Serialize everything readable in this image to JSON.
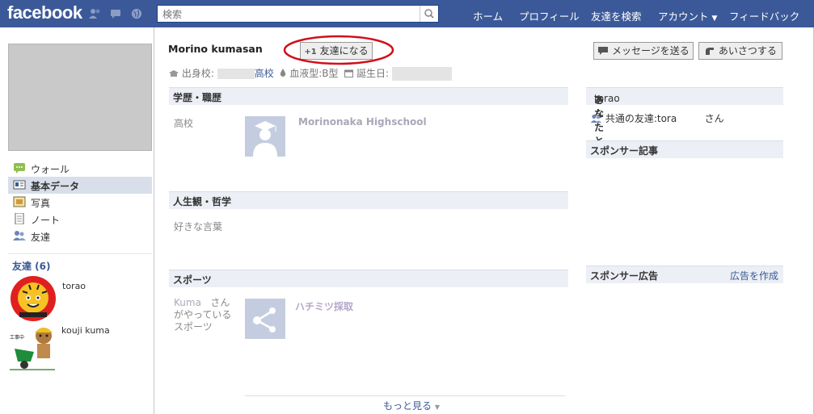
{
  "topbar": {
    "logo": "facebook",
    "search_placeholder": "検索",
    "nav": [
      "ホーム",
      "プロフィール",
      "友達を検索",
      "アカウント",
      "フィードバック"
    ]
  },
  "sidebar": {
    "items": [
      {
        "label": "ウォール",
        "icon": "wall-icon"
      },
      {
        "label": "基本データ",
        "icon": "info-icon",
        "selected": true
      },
      {
        "label": "写真",
        "icon": "photo-icon"
      },
      {
        "label": "ノート",
        "icon": "notes-icon"
      },
      {
        "label": "友達",
        "icon": "friends-icon"
      }
    ],
    "friends_title": "友達 (6)",
    "friends": [
      {
        "name": "torao"
      },
      {
        "name": "kouji kuma"
      }
    ]
  },
  "profile": {
    "name": "Morino kumasan",
    "add_friend_label": "友達になる",
    "add_friend_prefix": "+1",
    "send_message_label": "メッセージを送る",
    "poke_label": "あいさつする",
    "info": {
      "school_label": "出身校:",
      "school_suffix": "高校",
      "blood_label": "血液型:",
      "blood_value": "B型",
      "birthday_label": "誕生日:"
    }
  },
  "education": {
    "header": "学歴・職歴",
    "field_label": "高校",
    "school_name": "Morinonaka Highschool"
  },
  "philosophy": {
    "header": "人生観・哲学",
    "field_label": "好きな言葉"
  },
  "sports": {
    "header": "スポーツ",
    "field_name": "Kuma",
    "field_san": "さん",
    "field_rest1": "がやっている",
    "field_rest2": "スポーツ",
    "item": "ハチミツ採取"
  },
  "more_label": "もっと見る",
  "you_and": {
    "header_prefix": "あなたと",
    "header_name": "torao",
    "header_suffix": "さん",
    "mutual_label": "共通の友達:",
    "mutual_name": "tora",
    "mutual_suffix": "さん"
  },
  "sponsored_stories": {
    "header": "スポンサー記事"
  },
  "sponsored_ads": {
    "header": "スポンサー広告",
    "create_link": "広告を作成"
  },
  "colors": {
    "brand": "#3b5998",
    "highlight_circle": "#d0101a"
  }
}
